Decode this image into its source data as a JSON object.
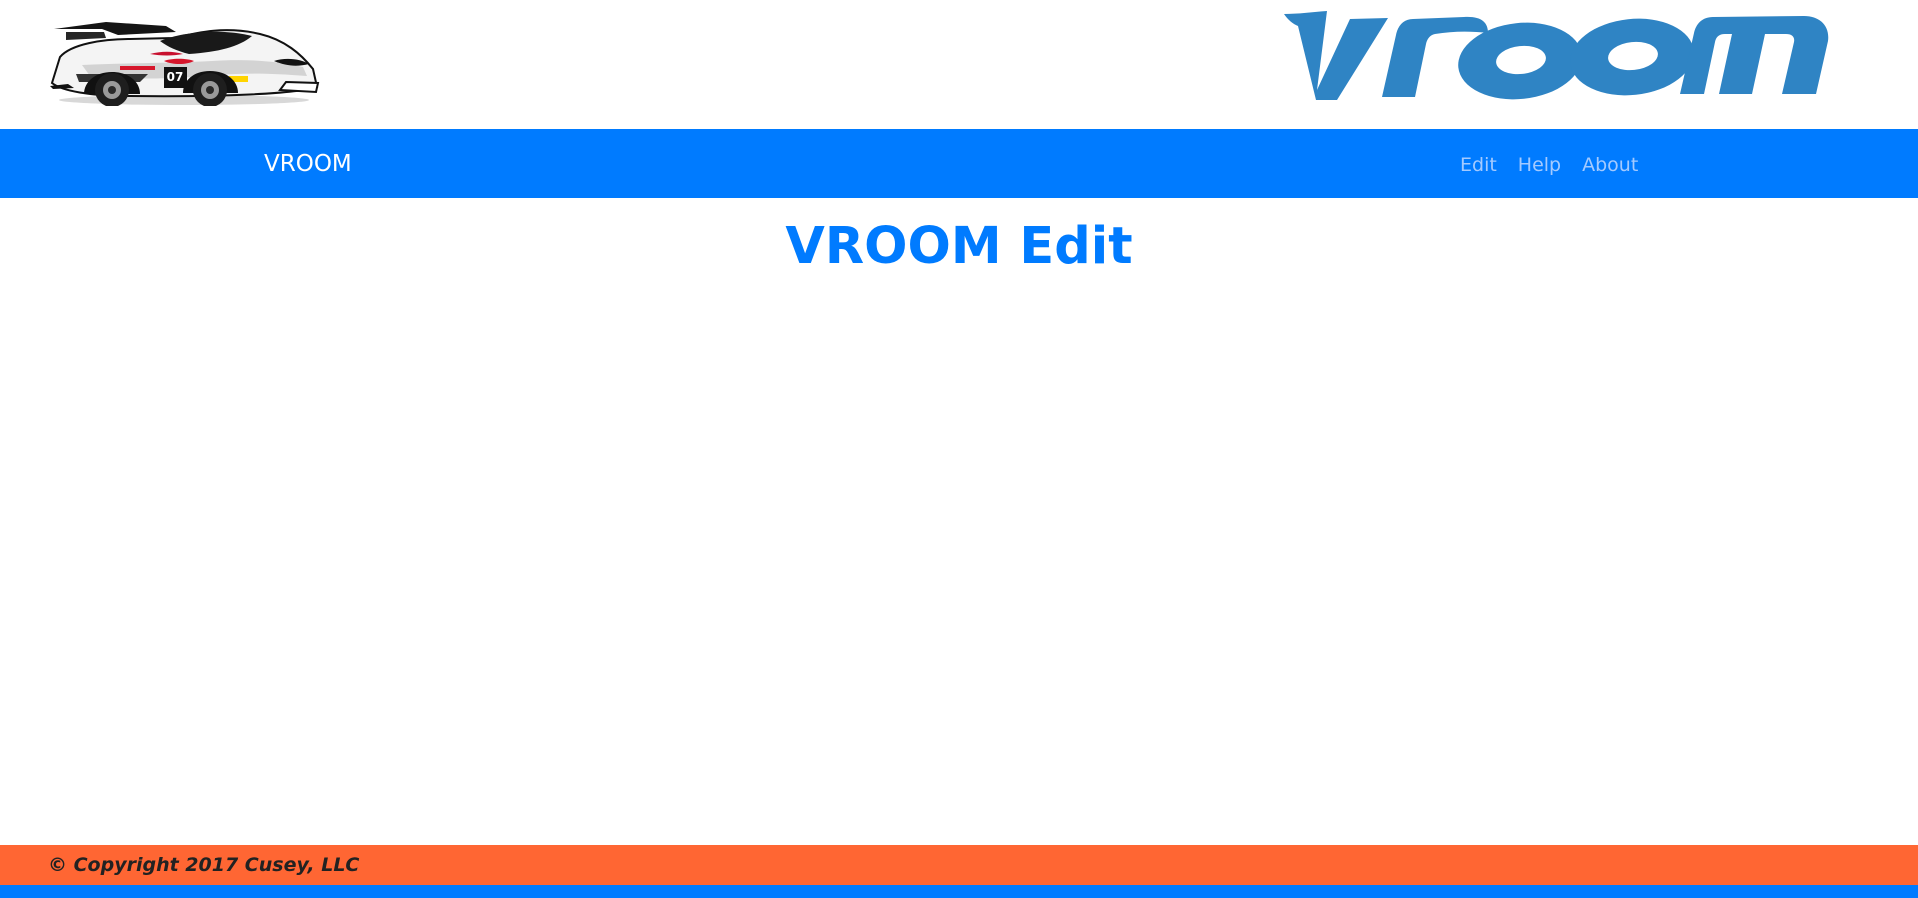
{
  "header": {
    "car_logo": "race-car-logo",
    "brand_logo": {
      "text": "vroom",
      "color": "#2f84c4"
    }
  },
  "navbar": {
    "brand": "VROOM",
    "links": [
      {
        "label": "Edit"
      },
      {
        "label": "Help"
      },
      {
        "label": "About"
      }
    ],
    "background": "#007bff"
  },
  "main": {
    "title": "VROOM Edit",
    "title_color": "#007bff"
  },
  "footer": {
    "copyright": "© Copyright 2017 Cusey, LLC",
    "background": "#ff6633"
  },
  "bottom_strip": {
    "color": "#007bff"
  }
}
